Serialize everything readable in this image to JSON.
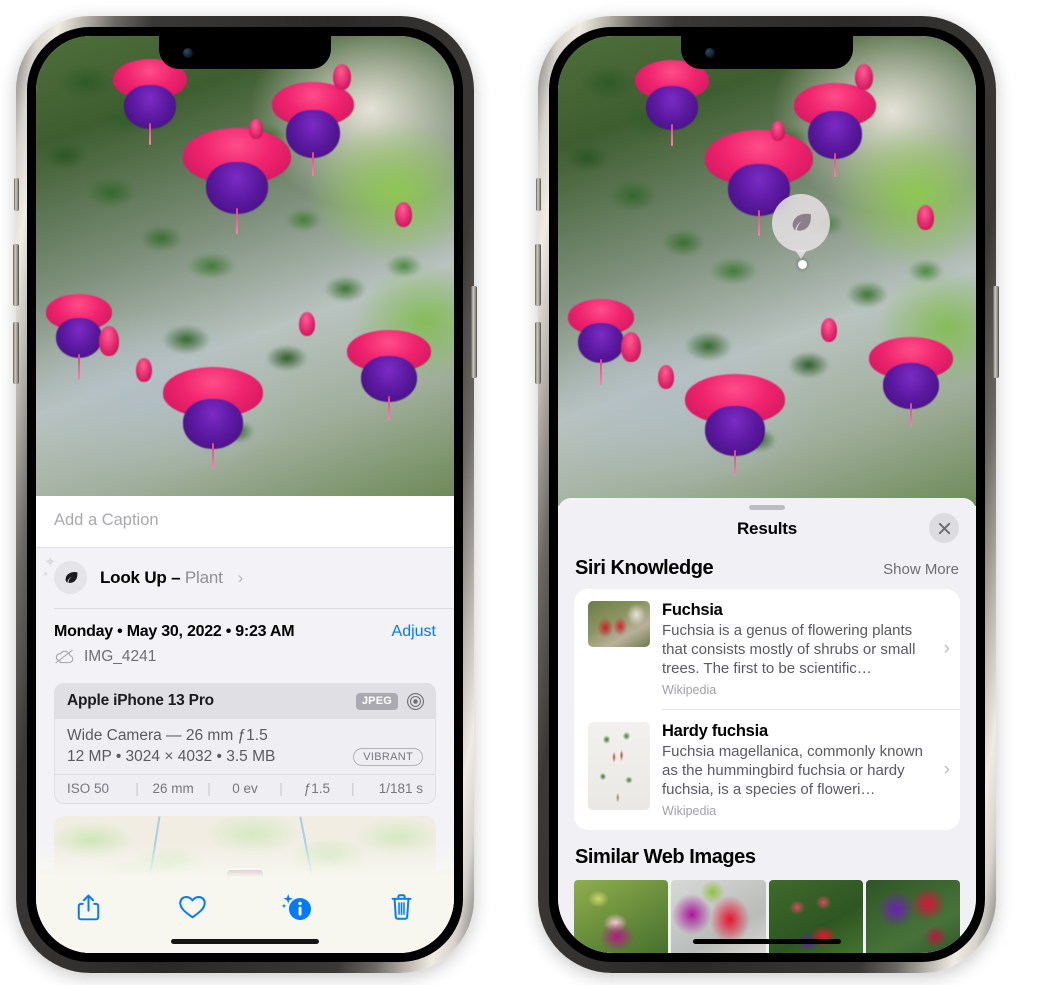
{
  "left_phone": {
    "name": "iphone-photos-info",
    "caption_placeholder": "Add a Caption",
    "caption_value": "",
    "lookup": {
      "label": "Look Up – ",
      "subject": "Plant",
      "chevron": "›",
      "icon": "leaf-icon"
    },
    "date": "Monday • May 30, 2022 • 9:23 AM",
    "adjust_label": "Adjust",
    "filename": "IMG_4241",
    "cloud_icon": "icloud-slash-icon",
    "exif": {
      "device": "Apple iPhone 13 Pro",
      "format_badge": "JPEG",
      "aperture_icon": "aperture-icon",
      "lens_line": "Wide Camera — 26 mm ƒ1.5",
      "size_line": "12 MP • 3024 × 4032 • 3.5 MB",
      "style_badge": "VIBRANT",
      "stats": [
        "ISO 50",
        "26 mm",
        "0 ev",
        "ƒ1.5",
        "1/181 s"
      ],
      "separator": "|"
    },
    "toolbar": [
      {
        "name": "share-button",
        "icon": "share-icon"
      },
      {
        "name": "favorite-button",
        "icon": "heart-icon"
      },
      {
        "name": "info-button",
        "icon": "info-sparkle-icon"
      },
      {
        "name": "delete-button",
        "icon": "trash-icon"
      }
    ],
    "accent_color": "#007aff"
  },
  "right_phone": {
    "name": "iphone-visual-lookup-results",
    "lookup_badge_icon": "leaf-icon",
    "sheet": {
      "title": "Results",
      "close_icon": "close-icon",
      "grabber": "drag-handle"
    },
    "siri_knowledge": {
      "section_title": "Siri Knowledge",
      "show_more_label": "Show More",
      "items": [
        {
          "title": "Fuchsia",
          "description": "Fuchsia is a genus of flowering plants that consists mostly of shrubs or small trees. The first to be scientific…",
          "source": "Wikipedia",
          "thumb": "fuchsia-red-flowers-thumb",
          "chevron": "›"
        },
        {
          "title": "Hardy fuchsia",
          "description": "Fuchsia magellanica, commonly known as the hummingbird fuchsia or hardy fuchsia, is a species of floweri…",
          "source": "Wikipedia",
          "thumb": "hardy-fuchsia-specimen-thumb",
          "chevron": "›"
        }
      ]
    },
    "similar_web_images": {
      "section_title": "Similar Web Images",
      "items": [
        {
          "name": "web-image-1",
          "alt": "pink and magenta fuchsia with green leaves"
        },
        {
          "name": "web-image-2",
          "alt": "red and magenta fuchsia closeup"
        },
        {
          "name": "web-image-3",
          "alt": "fuchsia bush with buds"
        },
        {
          "name": "web-image-4",
          "alt": "purple and red double fuchsia blooms"
        }
      ]
    }
  },
  "photo": {
    "subject": "fuchsia-flowers-hanging-basket",
    "description": "Pink and purple fuchsia flowers in a hanging basket on a porch"
  },
  "colors": {
    "accent_blue": "#007aff",
    "sheet_bg": "#f0f0f5",
    "info_bg": "#f3f3f7",
    "card_white": "#ffffff",
    "secondary_text": "#6e6e73",
    "tertiary_text": "#a0a0a6"
  }
}
